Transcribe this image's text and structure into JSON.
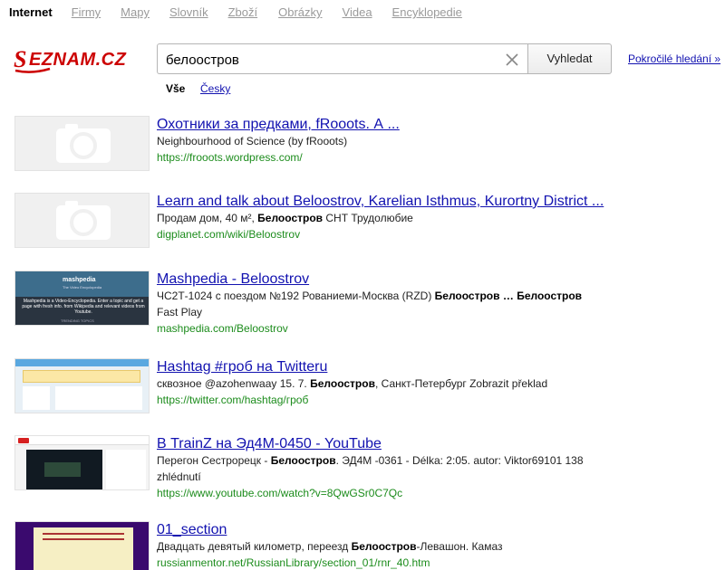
{
  "nav": {
    "items": [
      {
        "label": "Internet",
        "active": true
      },
      {
        "label": "Firmy",
        "active": false
      },
      {
        "label": "Mapy",
        "active": false
      },
      {
        "label": "Slovník",
        "active": false
      },
      {
        "label": "Zboží",
        "active": false
      },
      {
        "label": "Obrázky",
        "active": false
      },
      {
        "label": "Videa",
        "active": false
      },
      {
        "label": "Encyklopedie",
        "active": false
      }
    ]
  },
  "logo": {
    "text": "SEZNAM.CZ",
    "color": "#cc0000"
  },
  "search": {
    "value": "белоостров",
    "button_label": "Vyhledat",
    "advanced_label": "Pokročilé hledání »"
  },
  "lang_filter": {
    "all_label": "Vše",
    "czech_label": "Česky"
  },
  "colors": {
    "link": "#1212b0",
    "url": "#1c8c1c",
    "nav_inactive": "#9a9a9a"
  },
  "results": [
    {
      "title": "Охотники за предками, fRooots. А ...",
      "snippet": [
        {
          "t": "Neighbourhood of Science (by fRooots)",
          "b": false
        }
      ],
      "url": "https://frooots.wordpress.com/",
      "thumb": "placeholder"
    },
    {
      "title": "Learn and talk about Beloostrov, Karelian Isthmus, Kurortny District ...",
      "snippet": [
        {
          "t": "Продам дом, 40 м², ",
          "b": false
        },
        {
          "t": "Белоостров",
          "b": true
        },
        {
          "t": " СНТ Трудолюбие",
          "b": false
        }
      ],
      "url": "digplanet.com/wiki/Beloostrov",
      "thumb": "placeholder"
    },
    {
      "title": "Mashpedia - Beloostrov",
      "snippet": [
        {
          "t": "ЧС2Т-1024 с поездом №192 Рованиеми-Москва (RZD) ",
          "b": false
        },
        {
          "t": "Белоостров",
          "b": true
        },
        {
          "t": " … ",
          "b": true
        },
        {
          "t": "Белоостров",
          "b": true
        },
        {
          "t": " Fast Play",
          "b": false
        }
      ],
      "url": "mashpedia.com/Beloostrov",
      "thumb": "mashpedia",
      "thumb_text": {
        "brand": "mashpedia",
        "tagline": "The Video Encyclopedia",
        "desc": "Mashpedia is a Video-Encyclopedia. Enter a topic and get a page with fresh info. from Wikipedia and relevant videos from Youtube.",
        "footer": "TRENDING TOPICS"
      }
    },
    {
      "title": "Hashtag #гроб на Twitteru",
      "snippet": [
        {
          "t": "сквозное @azohenwaay 15. 7. ",
          "b": false
        },
        {
          "t": "Белоостров",
          "b": true
        },
        {
          "t": ", Санкт-Петербург Zobrazit překlad",
          "b": false
        }
      ],
      "url": "https://twitter.com/hashtag/гроб",
      "thumb": "twitter"
    },
    {
      "title": "В TrainZ на Эд4М-0450 - YouTube",
      "snippet": [
        {
          "t": "Перегон Сестрорецк - ",
          "b": false
        },
        {
          "t": "Белоостров",
          "b": true
        },
        {
          "t": ". ЭД4М -0361 - Délka: 2:05. autor: Viktor69101 138 zhlédnutí",
          "b": false
        }
      ],
      "url": "https://www.youtube.com/watch?v=8QwGSr0C7Qc",
      "thumb": "youtube"
    },
    {
      "title": "01_section",
      "snippet": [
        {
          "t": "Двадцать девятый километр, переезд ",
          "b": false
        },
        {
          "t": "Белоостров",
          "b": true
        },
        {
          "t": "-Левашон. Камаз",
          "b": false
        }
      ],
      "url": "russianmentor.net/RussianLibrary/section_01/rnr_40.htm",
      "thumb": "russianmentor"
    }
  ]
}
